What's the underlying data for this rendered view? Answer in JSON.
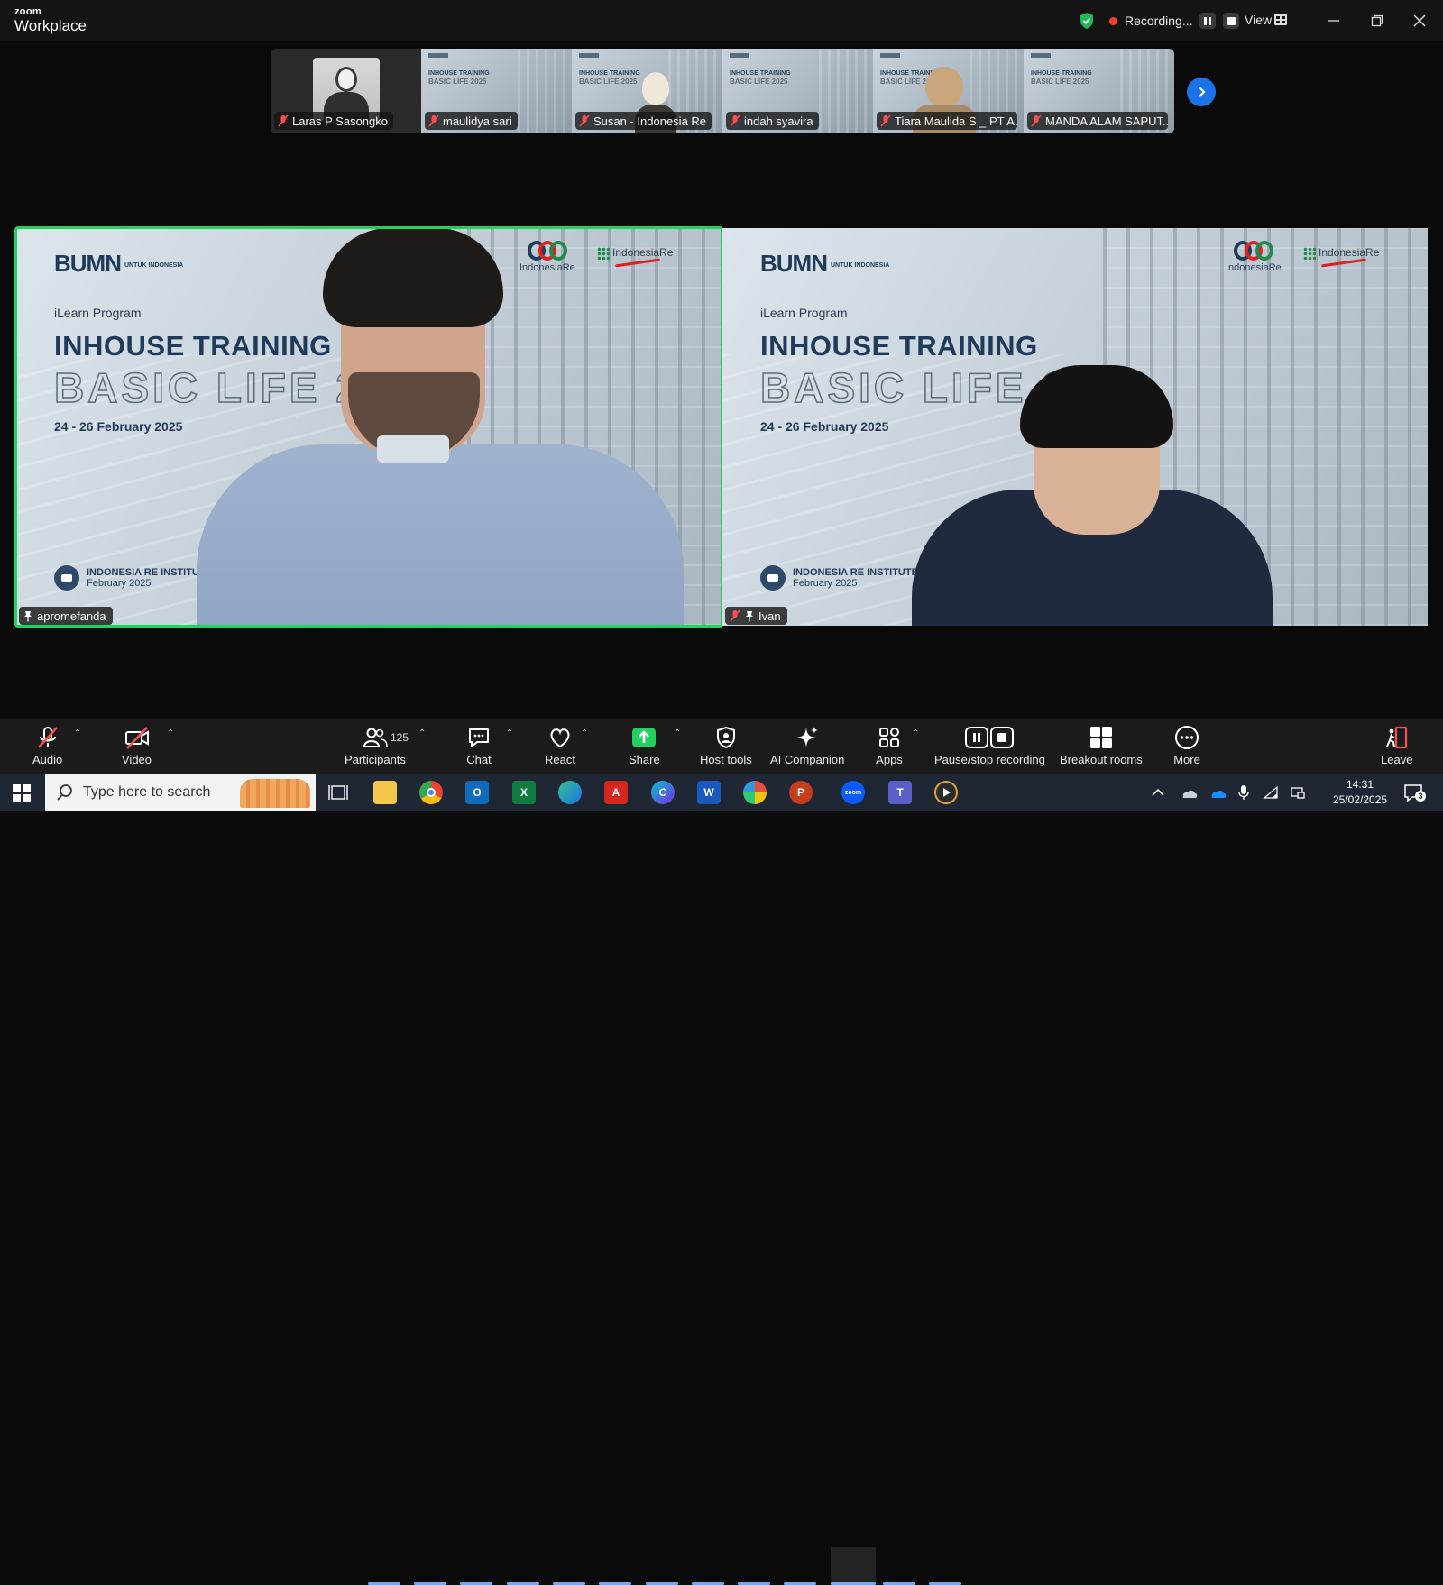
{
  "app": {
    "brand_top": "zoom",
    "brand_bottom": "Workplace"
  },
  "titlebar": {
    "recording_label": "Recording...",
    "view_label": "View",
    "security_icon": "shield-check-icon",
    "colors": {
      "security": "#1fba55",
      "recording_dot": "#ff3b30"
    }
  },
  "filmstrip": {
    "participants": [
      {
        "name": "Laras P Sasongko",
        "muted": true,
        "kind": "photo"
      },
      {
        "name": "maulidya sari",
        "muted": true,
        "kind": "slide"
      },
      {
        "name": "Susan - Indonesia Re",
        "muted": true,
        "kind": "slide-person"
      },
      {
        "name": "indah syavira",
        "muted": true,
        "kind": "slide"
      },
      {
        "name": "Tiara Maulida S _ PT A...",
        "muted": true,
        "kind": "slide-person"
      },
      {
        "name": "MANDA ALAM SAPUT...",
        "muted": true,
        "kind": "slide"
      }
    ],
    "next_icon": "chevron-right-icon"
  },
  "slide": {
    "bumn": "BUMN",
    "bumn_sub": "UNTUK INDONESIA",
    "indonesia_re": "IndonesiaRe",
    "indonesia_re_institute": "IndonesiaRe",
    "program": "iLearn Program",
    "title": "INHOUSE TRAINING",
    "subtitle": "BASIC LIFE 2025",
    "dates": "24 - 26 February 2025",
    "institute": "INDONESIA RE INSTITUTE",
    "institute_date": "February 2025"
  },
  "tiles": {
    "left": {
      "name": "apromefanda",
      "active_speaker": true,
      "colors": {
        "border": "#23d160"
      }
    },
    "right": {
      "name": "Ivan"
    }
  },
  "toolbar": {
    "audio": "Audio",
    "video": "Video",
    "participants": "Participants",
    "participants_count": "125",
    "chat": "Chat",
    "react": "React",
    "share": "Share",
    "host_tools": "Host tools",
    "ai_companion": "AI Companion",
    "apps": "Apps",
    "pause_stop": "Pause/stop recording",
    "breakout": "Breakout rooms",
    "more": "More",
    "leave": "Leave",
    "colors": {
      "share": "#23d160",
      "muted": "#ff4d4f"
    }
  },
  "taskbar": {
    "search_placeholder": "Type here to search",
    "time": "14:31",
    "date": "25/02/2025",
    "notification_count": "3",
    "apps": [
      "task-view-icon",
      "file-explorer-icon",
      "chrome-icon",
      "outlook-icon",
      "excel-icon",
      "edge-icon",
      "acrobat-icon",
      "canva-icon",
      "word-icon",
      "paint-icon",
      "powerpoint-icon",
      "zoom-icon",
      "teams-icon",
      "media-player-icon"
    ]
  }
}
